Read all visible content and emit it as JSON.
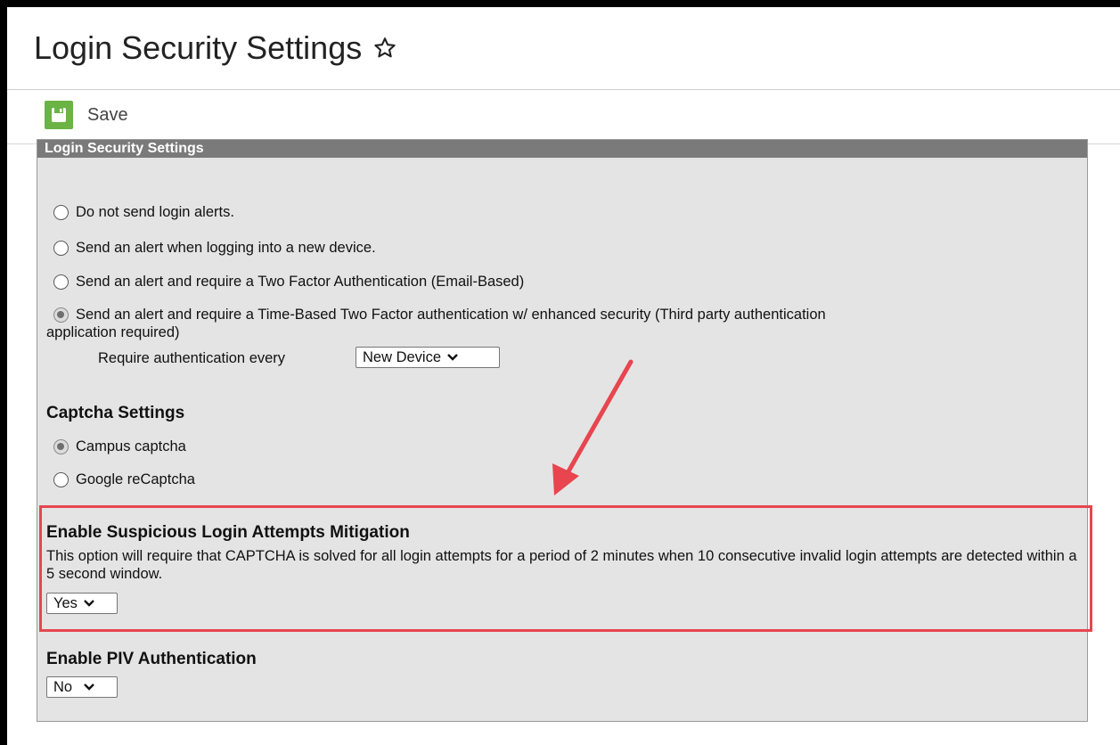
{
  "page": {
    "title": "Login Security Settings"
  },
  "toolbar": {
    "save_label": "Save"
  },
  "panel": {
    "header": "Login Security Settings",
    "alert_options": [
      {
        "label": "Do not send login alerts.",
        "checked": false
      },
      {
        "label": "Send an alert when logging into a new device.",
        "checked": false
      },
      {
        "label": "Send an alert and require a Two Factor Authentication (Email-Based)",
        "checked": false
      },
      {
        "label": "Send an alert and require a Time-Based Two Factor authentication w/ enhanced security (Third party authentication",
        "checked": true
      }
    ],
    "alert_option_4_wrap": "application required)",
    "require_auth_label": "Require authentication every",
    "require_auth_value": "New Device",
    "captcha": {
      "heading": "Captcha Settings",
      "options": [
        {
          "label": "Campus captcha",
          "checked": true
        },
        {
          "label": "Google reCaptcha",
          "checked": false
        }
      ]
    },
    "suspicious": {
      "heading": "Enable Suspicious Login Attempts Mitigation",
      "description": "This option will require that CAPTCHA is solved for all login attempts for a period of 2 minutes when 10 consecutive invalid login attempts are detected within a 5 second window.",
      "value": "Yes"
    },
    "piv": {
      "heading": "Enable PIV Authentication",
      "value": "No"
    }
  },
  "icons": {
    "star": "star-outline-icon",
    "save": "floppy-disk-icon",
    "chevron": "chevron-down-icon",
    "annotation_arrow": "arrow-icon"
  },
  "colors": {
    "save_green": "#6ab344",
    "panel_header": "#7a7a7a",
    "panel_bg": "#e4e4e4",
    "highlight_red": "#e8454f"
  }
}
